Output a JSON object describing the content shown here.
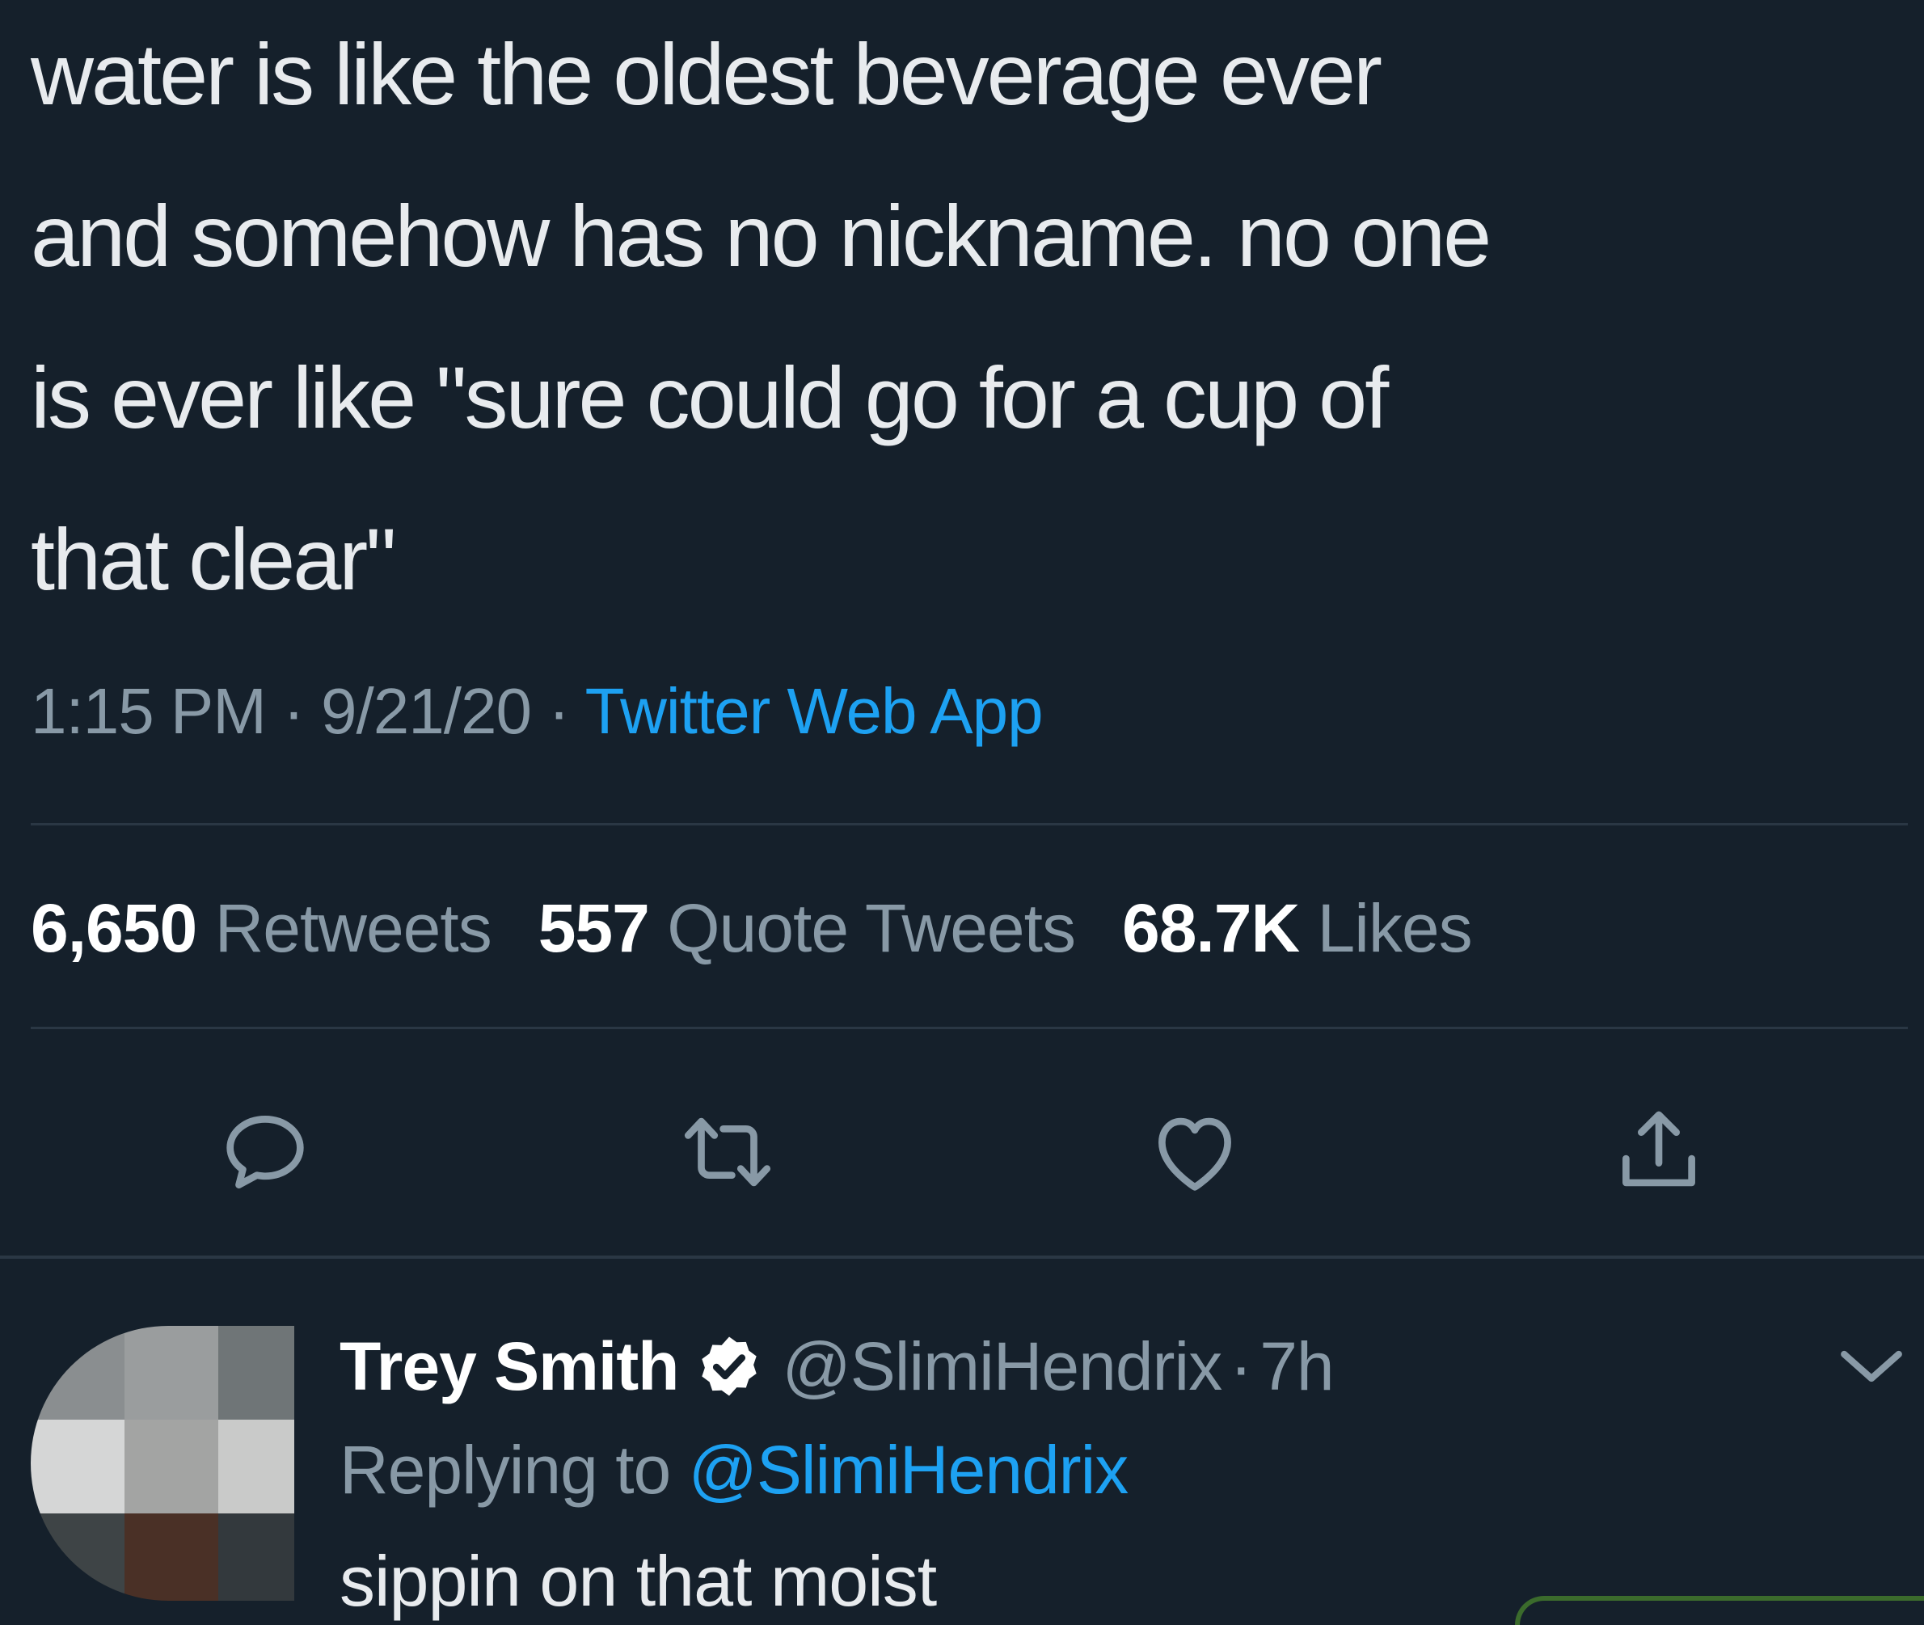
{
  "tweet": {
    "text_lines": [
      "water is like the oldest beverage ever",
      "and somehow has no nickname. no one",
      "is ever like \"sure could go for a cup of",
      "that clear\""
    ],
    "time": "1:15 PM",
    "date": "9/21/20",
    "separator": "·",
    "source": "Twitter Web App",
    "stats": {
      "retweets_count": "6,650",
      "retweets_label": "Retweets",
      "quotes_count": "557",
      "quotes_label": "Quote Tweets",
      "likes_count": "68.7K",
      "likes_label": "Likes"
    },
    "actions": [
      "reply-icon",
      "retweet-icon",
      "like-icon",
      "share-icon"
    ]
  },
  "reply": {
    "display_name": "Trey Smith",
    "handle": "@SlimiHendrix",
    "age": "7h",
    "replying_prefix": "Replying to",
    "replying_to": "@SlimiHendrix",
    "text": "sippin on that moist",
    "verified": true
  },
  "colors": {
    "background": "#15202b",
    "text": "#e8ebee",
    "muted": "#8899a6",
    "accent": "#1da1f2",
    "divider": "#2a3744"
  }
}
